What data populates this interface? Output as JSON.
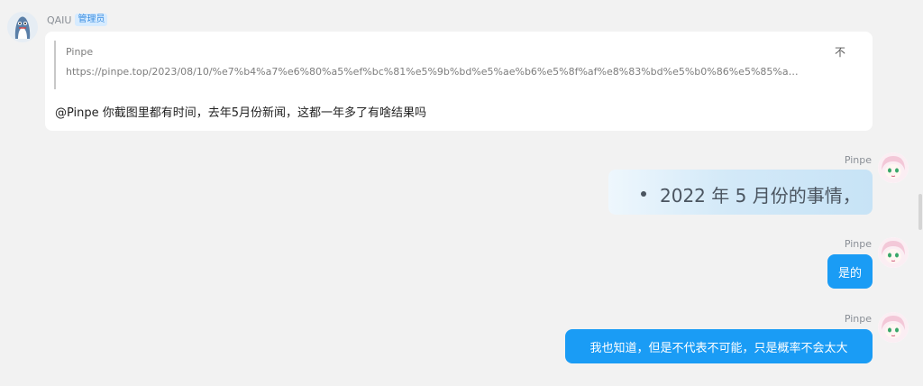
{
  "messages": {
    "left": {
      "sender": "QAIU",
      "badge": "管理员",
      "avatar_icon": "shark-avatar-icon",
      "quote": {
        "author": "Pinpe",
        "url": "https://pinpe.top/2023/08/10/%e7%b4%a7%e6%80%a5%ef%bc%81%e5%9b%bd%e5%ae%b6%e5%8f%af%e8%83%bd%e5%b0%86%e5%85%a…",
        "collapse_label": "不"
      },
      "text": "@Pinpe 你截图里都有时间，去年5月份新闻，这都一年多了有啥结果吗"
    },
    "right": [
      {
        "sender": "Pinpe",
        "text": "2022 年 5 月份的事情，",
        "style": "gradient-bullet"
      },
      {
        "sender": "Pinpe",
        "text": "是的",
        "style": "blue"
      },
      {
        "sender": "Pinpe",
        "text": "我也知道，但是不代表不可能，只是概率不会太大",
        "style": "blue"
      }
    ]
  },
  "colors": {
    "bubble_blue": "#1a9cf5",
    "badge_bg": "#d6ebff",
    "badge_text": "#3d8fe0",
    "background": "#f2f2f2"
  }
}
